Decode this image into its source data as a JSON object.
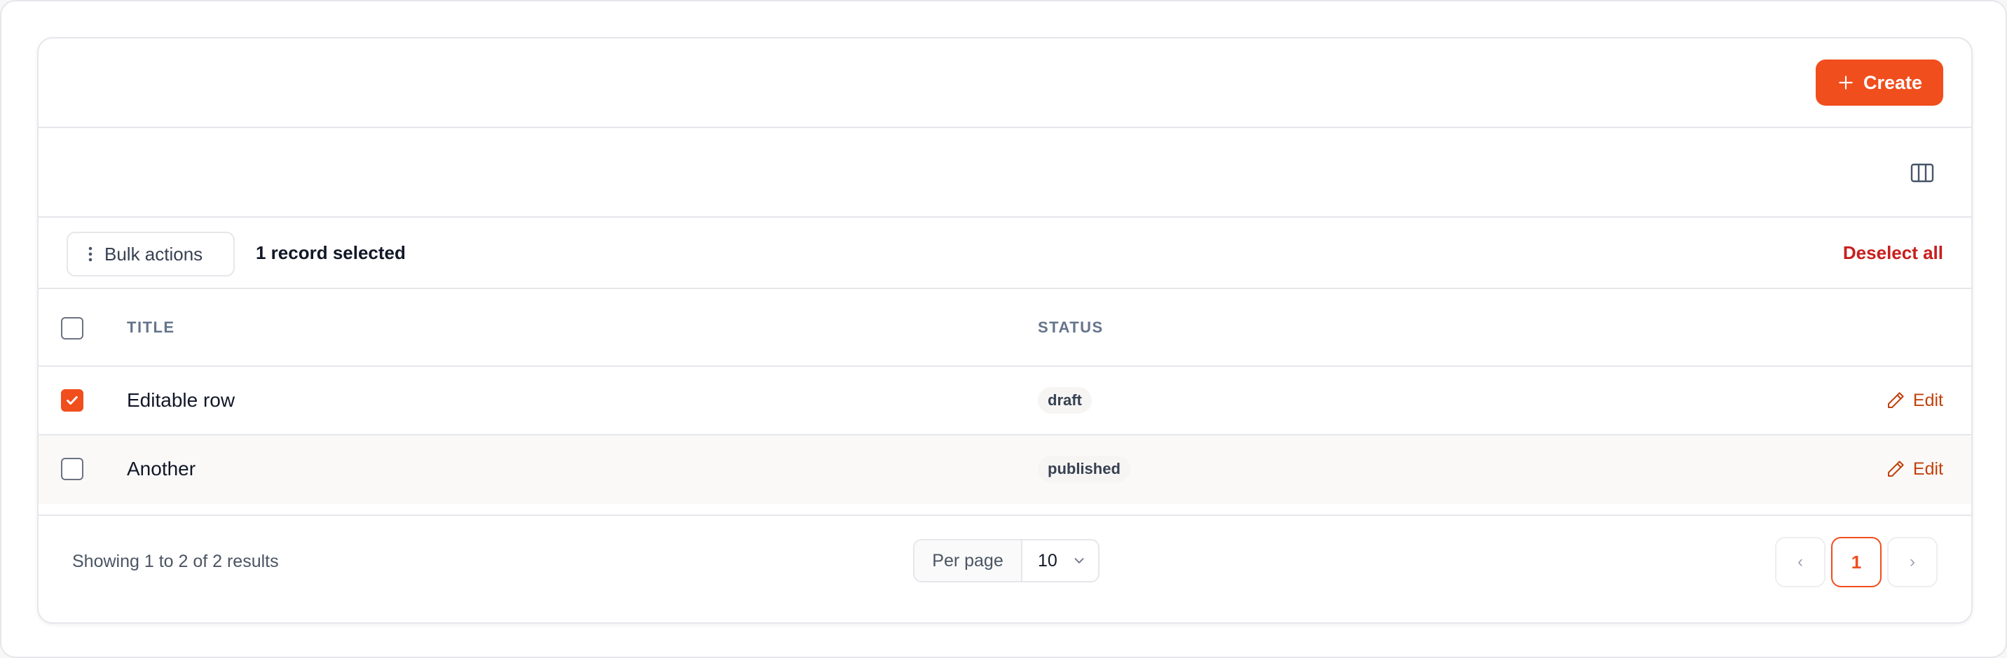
{
  "header": {
    "create_label": "Create"
  },
  "bulk": {
    "actions_label": "Bulk actions",
    "selected_text": "1 record selected",
    "deselect_label": "Deselect all"
  },
  "table": {
    "columns": [
      "TITLE",
      "STATUS"
    ],
    "header_checkbox_checked": false,
    "rows": [
      {
        "title": "Editable row",
        "status": "draft",
        "checked": true,
        "action": "Edit"
      },
      {
        "title": "Another",
        "status": "published",
        "checked": false,
        "action": "Edit"
      }
    ]
  },
  "footer": {
    "results_text": "Showing 1 to 2 of 2 results",
    "per_page_label": "Per page",
    "per_page_value": "10",
    "pagination": {
      "prev": "‹",
      "current_page": "1",
      "next": "›"
    }
  },
  "colors": {
    "accent": "#f04e1d",
    "danger": "#c81e1e",
    "edit": "#c2410c"
  },
  "icons": [
    "plus-icon",
    "columns-icon",
    "dots-vertical-icon",
    "check-icon",
    "pencil-icon",
    "chevron-down-icon"
  ]
}
